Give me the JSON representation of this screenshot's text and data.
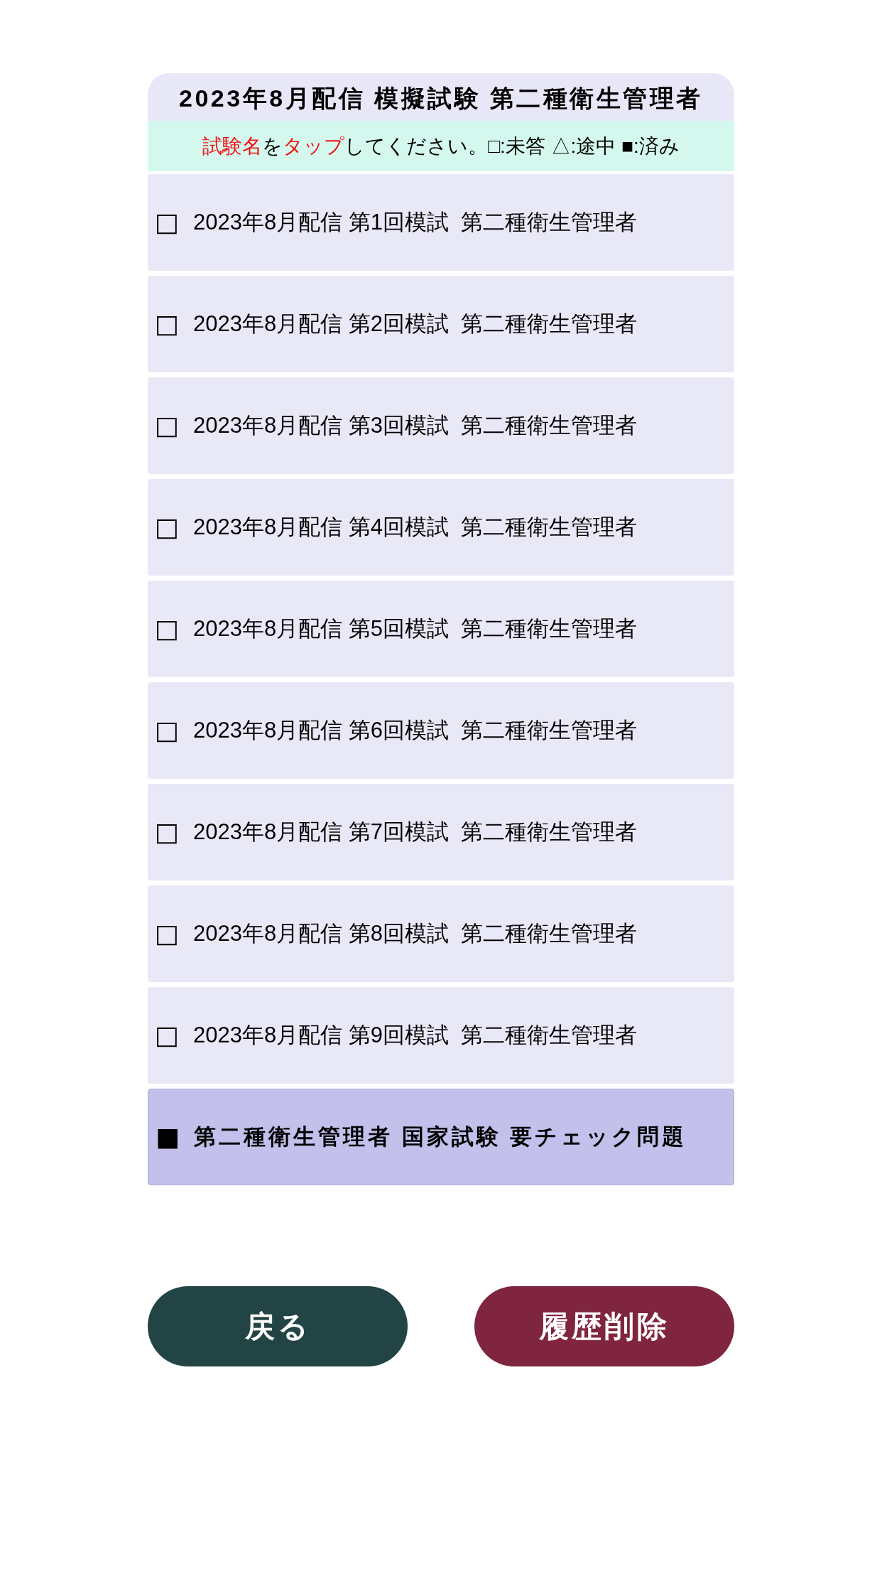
{
  "header": {
    "title": "2023年8月配信 模擬試験 第二種衛生管理者"
  },
  "instruction": {
    "parts": [
      {
        "text": "試験名",
        "kind": "highlight"
      },
      {
        "text": "を",
        "kind": "plain"
      },
      {
        "text": "タップ",
        "kind": "highlight"
      },
      {
        "text": "してください。□:未答 △:途中 ■:済み",
        "kind": "plain"
      }
    ]
  },
  "exams": [
    {
      "kind": "exam",
      "status": "□",
      "title": "2023年8月配信 第1回模試  第二種衛生管理者"
    },
    {
      "kind": "exam",
      "status": "□",
      "title": "2023年8月配信 第2回模試  第二種衛生管理者"
    },
    {
      "kind": "exam",
      "status": "□",
      "title": "2023年8月配信 第3回模試  第二種衛生管理者"
    },
    {
      "kind": "exam",
      "status": "□",
      "title": "2023年8月配信 第4回模試  第二種衛生管理者"
    },
    {
      "kind": "exam",
      "status": "□",
      "title": "2023年8月配信 第5回模試  第二種衛生管理者"
    },
    {
      "kind": "exam",
      "status": "□",
      "title": "2023年8月配信 第6回模試  第二種衛生管理者"
    },
    {
      "kind": "exam",
      "status": "□",
      "title": "2023年8月配信 第7回模試  第二種衛生管理者"
    },
    {
      "kind": "exam",
      "status": "□",
      "title": "2023年8月配信 第8回模試  第二種衛生管理者"
    },
    {
      "kind": "exam",
      "status": "□",
      "title": "2023年8月配信 第9回模試  第二種衛生管理者"
    },
    {
      "kind": "review",
      "status": "■",
      "title": "第二種衛生管理者 国家試験 要チェック問題"
    }
  ],
  "buttons": [
    {
      "kind": "back",
      "label": "戻る"
    },
    {
      "kind": "delete",
      "label": "履歴削除"
    }
  ]
}
